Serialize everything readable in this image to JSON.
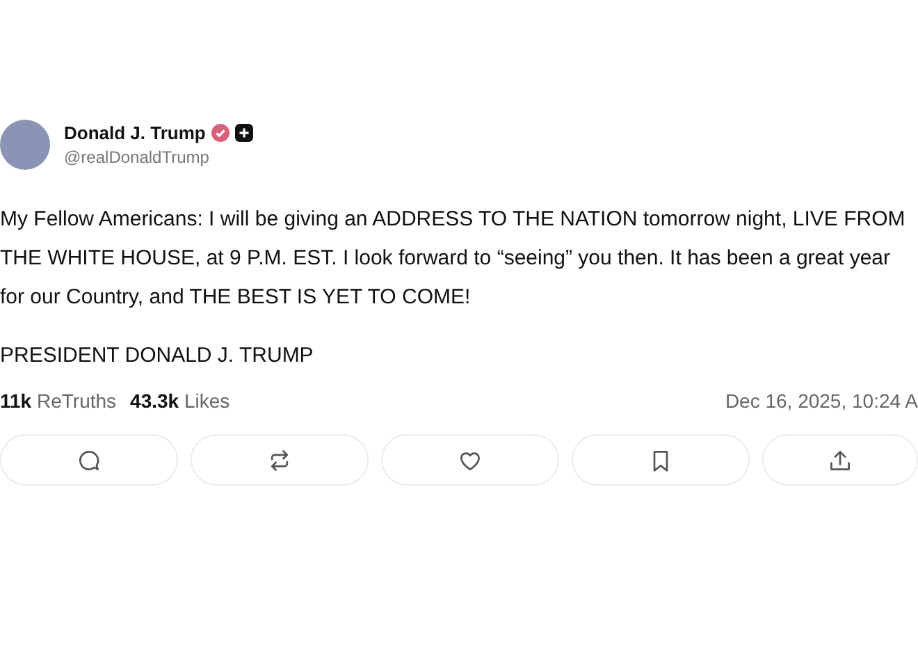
{
  "post": {
    "author": {
      "name": "Donald J. Trump",
      "handle": "@realDonaldTrump",
      "verified": true
    },
    "body": [
      "My Fellow Americans: I will be giving an ADDRESS TO THE NATION tomorrow night, LIVE FROM THE WHITE HOUSE, at 9 P.M. EST. I look forward to “seeing” you then. It has been a great year for our Country, and THE BEST IS YET TO COME!",
      "PRESIDENT DONALD J. TRUMP"
    ],
    "stats": [
      {
        "count": "11k",
        "label": "ReTruths"
      },
      {
        "count": "43.3k",
        "label": "Likes"
      }
    ],
    "date": "Dec 16, 2025, 10:24 A",
    "actions": [
      {
        "kind": "reply"
      },
      {
        "kind": "repost"
      },
      {
        "kind": "like"
      },
      {
        "kind": "bookmark"
      },
      {
        "kind": "share"
      }
    ]
  }
}
